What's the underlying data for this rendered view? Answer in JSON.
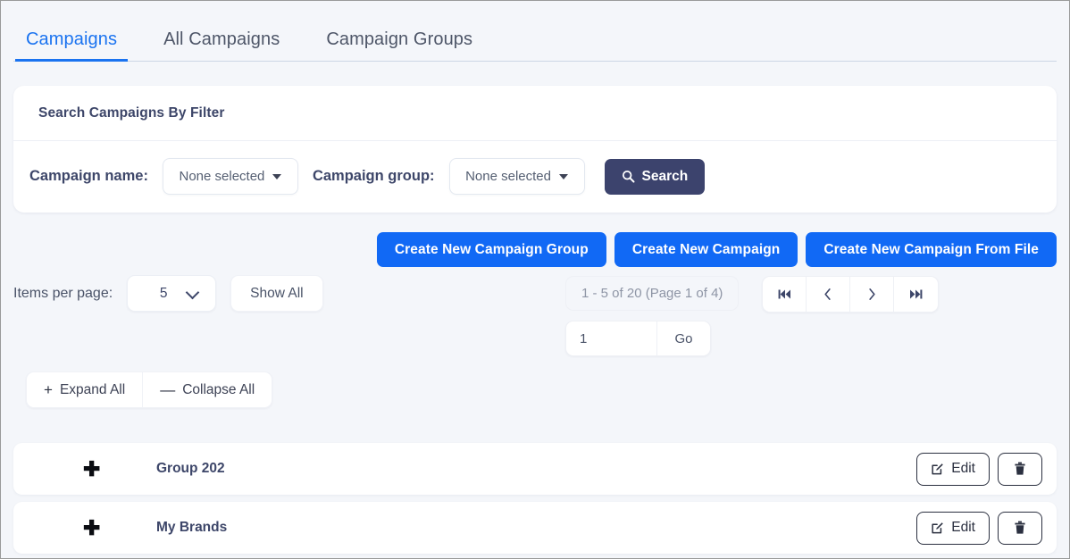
{
  "tabs": [
    {
      "label": "Campaigns",
      "active": true
    },
    {
      "label": "All Campaigns",
      "active": false
    },
    {
      "label": "Campaign Groups",
      "active": false
    }
  ],
  "filter_card": {
    "title": "Search Campaigns By Filter",
    "campaign_name_label": "Campaign name:",
    "campaign_name_value": "None selected",
    "campaign_group_label": "Campaign group:",
    "campaign_group_value": "None selected",
    "search_button": "Search",
    "search_icon": "search-icon"
  },
  "create_buttons": [
    {
      "label": "Create New Campaign Group"
    },
    {
      "label": "Create New Campaign"
    },
    {
      "label": "Create New Campaign From File"
    }
  ],
  "controls": {
    "items_per_page_label": "Items per page:",
    "items_per_page_value": "5",
    "show_all_label": "Show All"
  },
  "pagination": {
    "info": "1 - 5 of 20 (Page 1 of 4)",
    "first_icon": "first-page-icon",
    "prev_icon": "previous-page-icon",
    "next_icon": "next-page-icon",
    "last_icon": "last-page-icon",
    "page_input_value": "1",
    "go_label": "Go"
  },
  "tree_controls": {
    "expand_all_label": "Expand All",
    "expand_symbol": "+",
    "collapse_all_label": "Collapse All",
    "collapse_symbol": "—"
  },
  "groups": [
    {
      "name": "Group 202",
      "edit_label": "Edit"
    },
    {
      "name": "My Brands",
      "edit_label": "Edit"
    }
  ],
  "colors": {
    "accent_blue": "#1169f5",
    "tab_active": "#1a73f0",
    "search_navy": "#3c436d",
    "page_bg": "#f4f6fa",
    "text_dark": "#3d4669"
  }
}
